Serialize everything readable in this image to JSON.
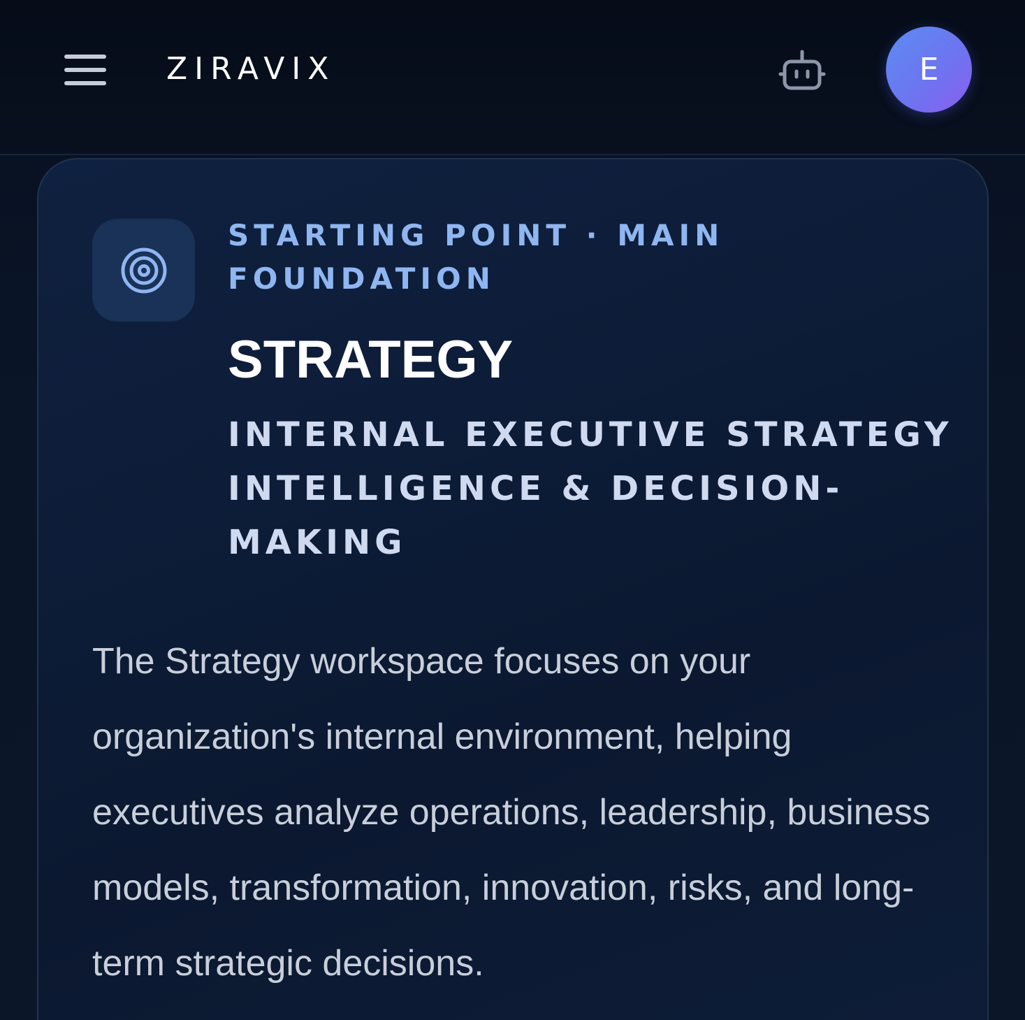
{
  "header": {
    "menu_icon": "hamburger-menu-icon",
    "brand": "ZIRAVIX",
    "assistant_icon": "robot-icon",
    "avatar_initial": "E",
    "avatar_gradient": [
      "#5b8cf2",
      "#8a5ef0"
    ]
  },
  "card": {
    "icon": "target-icon",
    "eyebrow": "STARTING POINT · MAIN FOUNDATION",
    "title": "STRATEGY",
    "subtitle": "INTERNAL EXECUTIVE STRATEGY INTELLIGENCE & DECISION-MAKING",
    "description": "The Strategy workspace focuses on your organization's internal environment, helping executives analyze operations, leadership, business models, transformation, innovation, risks, and long-term strategic decisions."
  },
  "colors": {
    "background": "#081224",
    "card_background": "#0d1c37",
    "accent_text": "#8fb6f0",
    "icon_tile": "#1a3158"
  }
}
